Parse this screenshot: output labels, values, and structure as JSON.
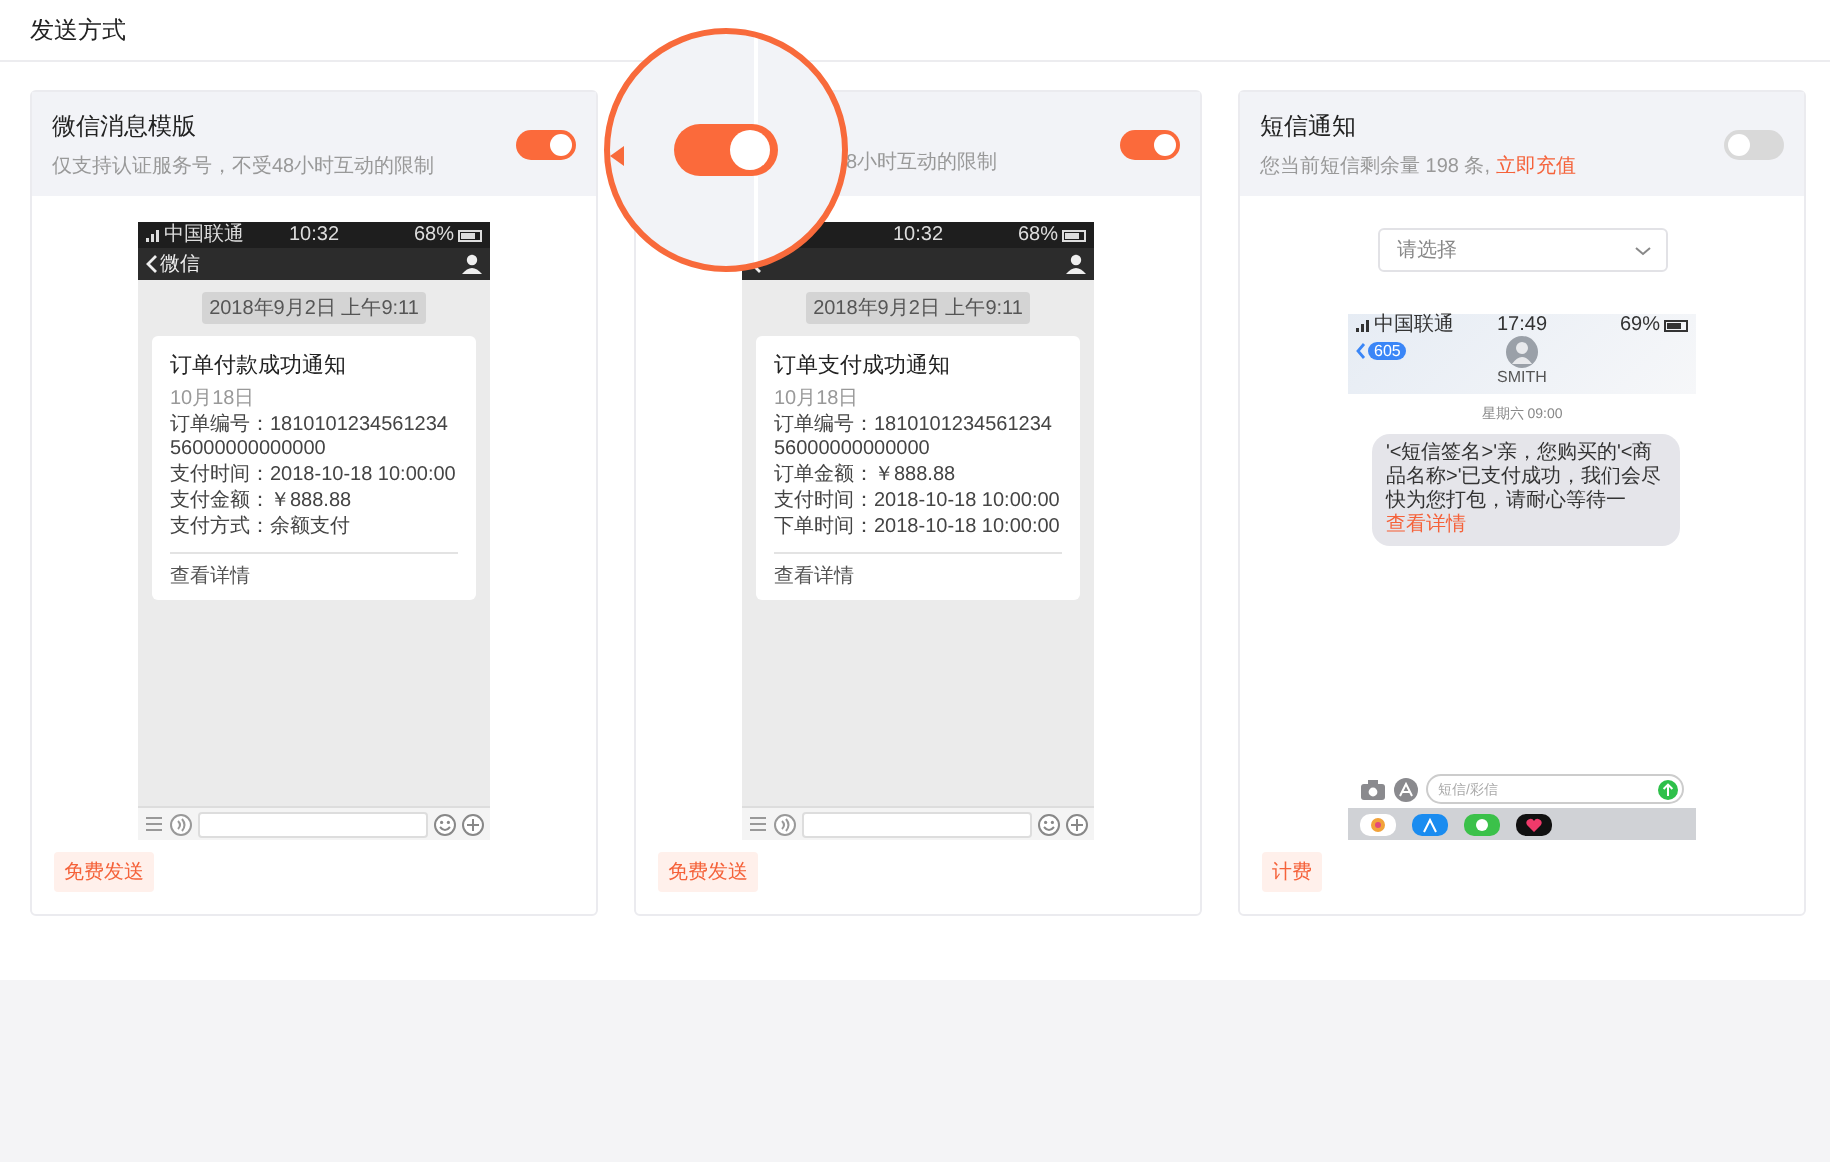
{
  "page_title": "发送方式",
  "cards": [
    {
      "kind": "wechat",
      "title": "微信消息模版",
      "subtitle": "仅支持认证服务号，不受48小时互动的限制",
      "toggle": {
        "on": true
      },
      "preview": {
        "carrier": "中国联通",
        "time": "10:32",
        "battery": "68%",
        "back_label": "微信",
        "date": "2018年9月2日 上午9:11",
        "message_title": "订单付款成功通知",
        "message_date": "10月18日",
        "lines": [
          "订单编号：181010123456123456000000000000",
          "支付时间：2018-10-18 10:00:00",
          "支付金额：￥888.88",
          "支付方式：余额支付"
        ],
        "link": "查看详情"
      },
      "tag": "免费发送"
    },
    {
      "kind": "wechat",
      "subtitle": "8小时互动的限制",
      "toggle": {
        "on": true
      },
      "preview": {
        "time": "10:32",
        "battery": "68%",
        "date": "2018年9月2日 上午9:11",
        "message_title": "订单支付成功通知",
        "message_date": "10月18日",
        "lines": [
          "订单编号：181010123456123456000000000000",
          "订单金额：￥888.88",
          "支付时间：2018-10-18 10:00:00",
          "下单时间：2018-10-18 10:00:00"
        ],
        "link": "查看详情"
      },
      "tag": "免费发送"
    },
    {
      "kind": "sms",
      "title": "短信通知",
      "subtitle": "您当前短信剩余量 198 条, ",
      "subtitle_link": "立即充值",
      "toggle": {
        "on": false
      },
      "select": {
        "placeholder": "请选择"
      },
      "preview": {
        "carrier": "中国联通",
        "time": "17:49",
        "battery": "69%",
        "back_badge": "605",
        "contact": "SMITH",
        "timestamp": "星期六 09:00",
        "bubble": "'<短信签名>'亲，您购买的'<商品名称>'已支付成功，我们会尽快为您打包，请耐心等待一",
        "link": "查看详情",
        "input_placeholder": "短信/彩信"
      },
      "tag": "计费"
    }
  ],
  "magnifier": {
    "toggle": {
      "on": true
    }
  }
}
